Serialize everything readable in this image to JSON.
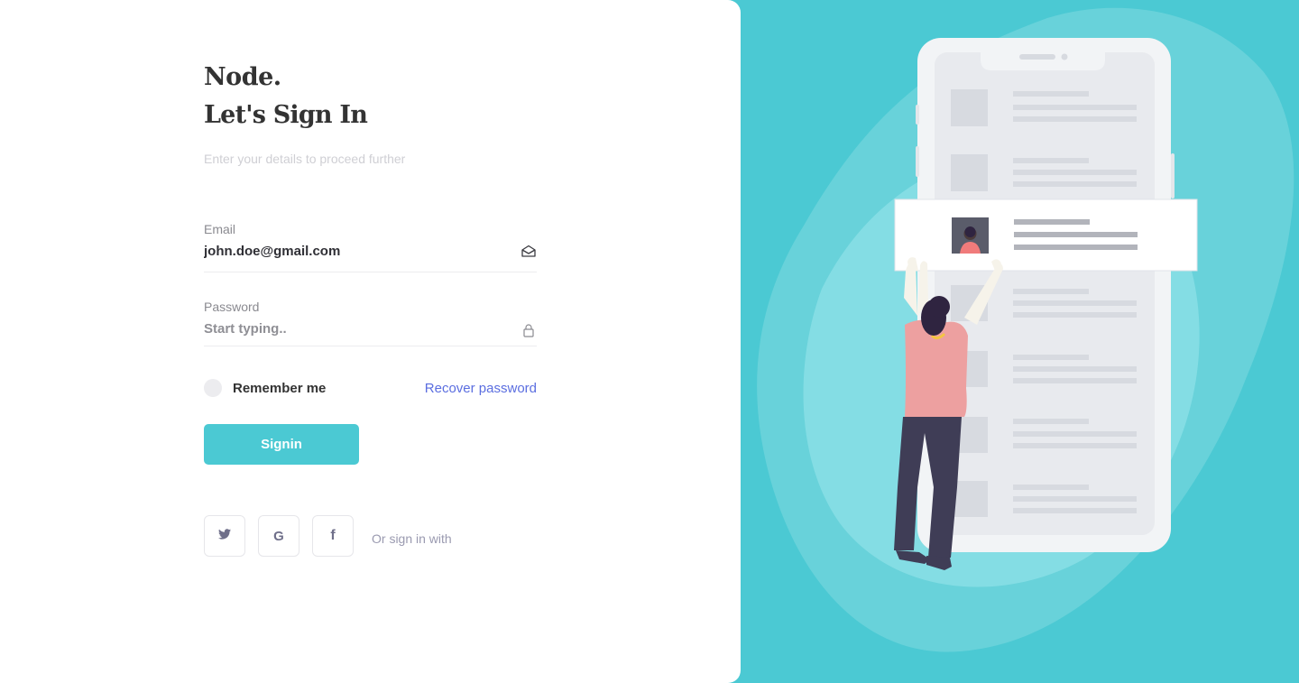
{
  "brand": "Node.",
  "headline": "Let's Sign In",
  "subtitle": "Enter your details to proceed further",
  "email": {
    "label": "Email",
    "value": "john.doe@gmail.com",
    "icon": "envelope-open-icon"
  },
  "password": {
    "label": "Password",
    "placeholder": "Start typing..",
    "icon": "lock-icon"
  },
  "remember": {
    "label": "Remember me",
    "checked": false
  },
  "recover_link": "Recover password",
  "signin_button": "Signin",
  "social": {
    "buttons": [
      {
        "icon": "twitter-icon"
      },
      {
        "icon": "google-icon",
        "glyph": "G"
      },
      {
        "icon": "facebook-icon",
        "glyph": "f"
      }
    ],
    "caption": "Or sign in with"
  },
  "colors": {
    "accent": "#4bc9d3",
    "link": "#5b6ee0",
    "heading": "#333333"
  }
}
